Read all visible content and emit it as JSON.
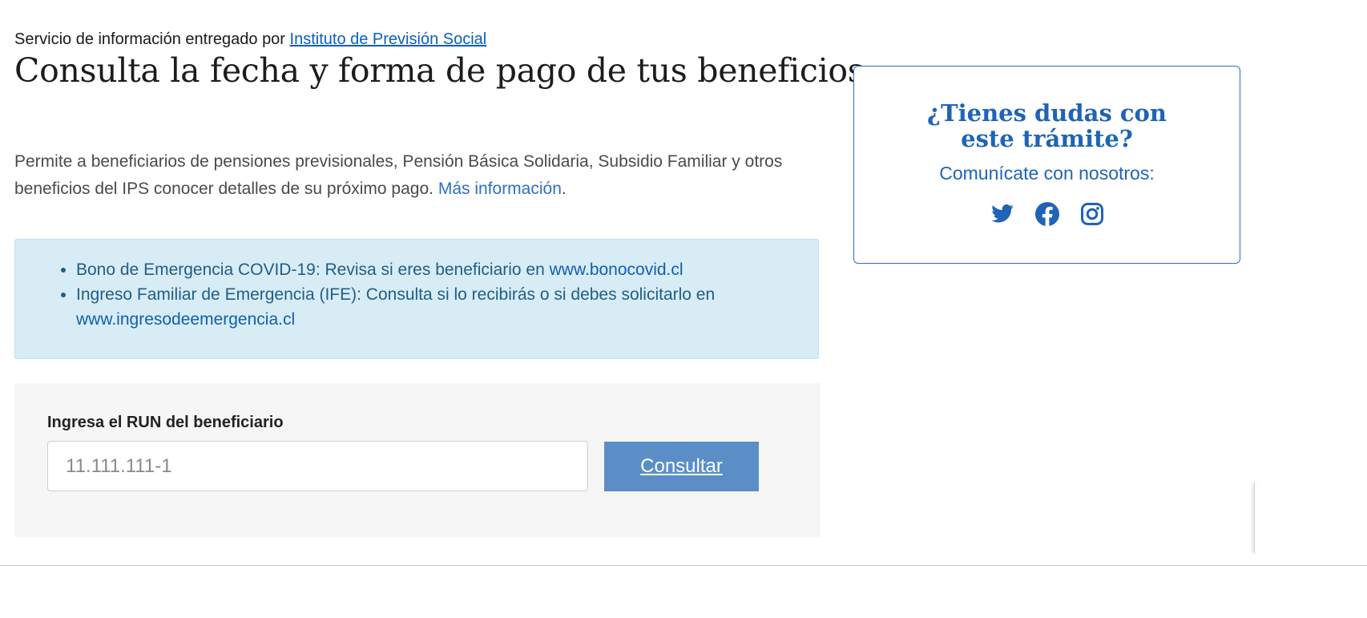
{
  "header": {
    "provider_prefix": "Servicio de información entregado por",
    "provider_link": "Instituto de Previsión Social",
    "title": "Consulta la fecha y forma de pago de tus beneficios"
  },
  "description": {
    "text": "Permite a beneficiarios de pensiones previsionales, Pensión Básica Solidaria, Subsidio Familiar y otros beneficios del IPS conocer detalles de su próximo pago.",
    "more_link": "Más información",
    "end": "."
  },
  "alert": {
    "items": [
      {
        "text": "Bono de Emergencia COVID-19: Revisa si eres beneficiario en",
        "link": "www.bonocovid.cl"
      },
      {
        "text": "Ingreso Familiar de Emergencia (IFE): Consulta si lo recibirás o si debes solicitarlo en",
        "link": "www.ingresodeemergencia.cl"
      }
    ]
  },
  "form": {
    "label": "Ingresa el RUN del beneficiario",
    "placeholder": "11.111.111-1",
    "value": "",
    "button_label": "Consultar"
  },
  "help": {
    "title": "¿Tienes dudas con este trámite?",
    "subtitle": "Comunícate con nosotros:",
    "social_icons": [
      "twitter-icon",
      "facebook-icon",
      "instagram-icon"
    ],
    "icon_color": "#1f64b5"
  },
  "colors": {
    "link": "#0a5ec2",
    "alert_bg": "#d8ecf6",
    "button_bg": "#5b8ec7",
    "accent": "#1f64b5"
  }
}
